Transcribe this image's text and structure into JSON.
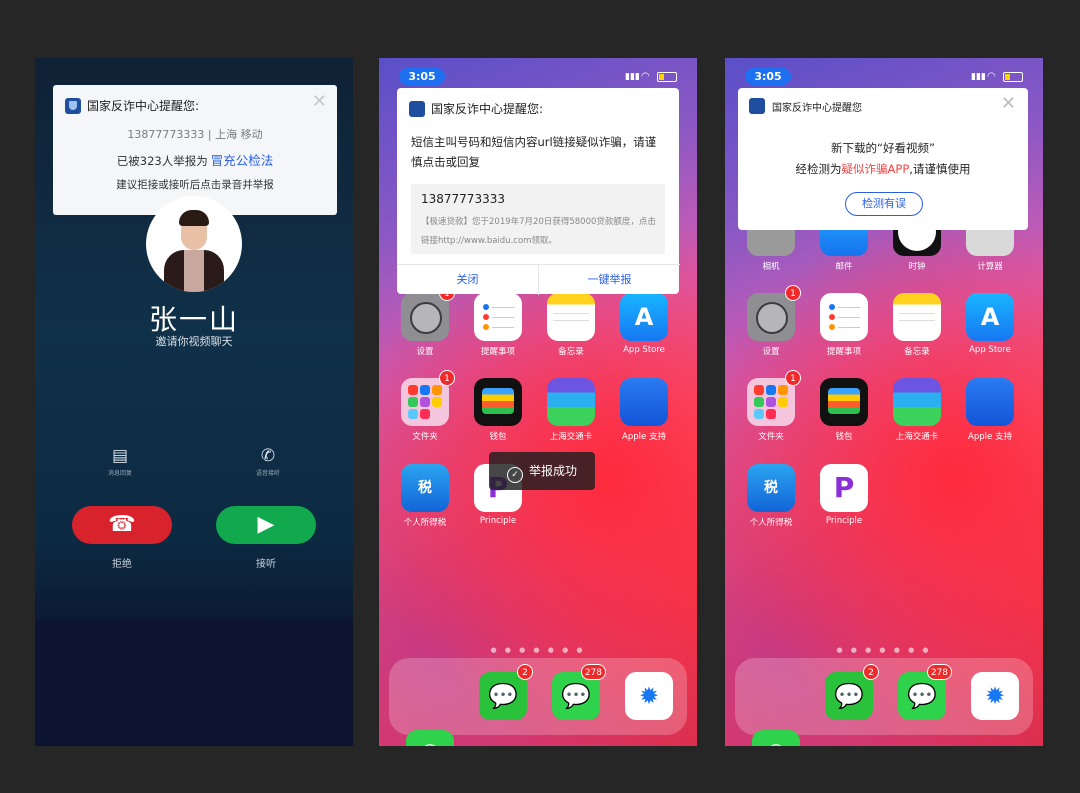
{
  "phone1": {
    "notification": {
      "title": "国家反诈中心提醒您:",
      "close": "✕",
      "number_line": "13877773333 | 上海 移动",
      "report_prefix": "已被323人举报为",
      "report_tag": "冒充公检法",
      "advice": "建议拒接或接听后点击录音并举报"
    },
    "caller_name": "张一山",
    "caller_subtitle": "邀请你视频聊天",
    "option_left": "消息回复",
    "option_right": "语音接听",
    "decline_label": "拒绝",
    "answer_label": "接听"
  },
  "phone2": {
    "time": "3:05",
    "notification": {
      "title": "国家反诈中心提醒您:",
      "body": "短信主叫号码和短信内容url链接疑似诈骗，请谨慎点击或回复",
      "sms_number": "13877773333",
      "sms_text": "【极速贷款】您于2019年7月20日获得58000贷款额度，点击链接http://www.baidu.com领取。",
      "action_close": "关闭",
      "action_report": "一键举报"
    },
    "toast": "举报成功"
  },
  "phone3": {
    "time": "3:05",
    "notification": {
      "title": "国家反诈中心提醒您",
      "close": "✕",
      "line1": "新下载的“好看视频”",
      "line2_prefix": "经检测为",
      "line2_warn": "疑似诈骗APP",
      "line2_suffix": ",请谨慎使用",
      "button": "检测有误"
    },
    "row0_labels": [
      "相机",
      "邮件",
      "时钟",
      "计算器"
    ]
  },
  "apps": {
    "settings": "设置",
    "reminders": "提醒事项",
    "notes": "备忘录",
    "appstore": "App Store",
    "folder": "文件夹",
    "wallet": "钱包",
    "transit": "上海交通卡",
    "applesupport": "Apple 支持",
    "tax": "个人所得税",
    "principle": "Principle"
  },
  "badges": {
    "settings": "1",
    "folder": "1",
    "wechat": "2",
    "messages": "278"
  },
  "icons": {
    "appstore_glyph": "A",
    "tax_glyph": "税",
    "principle_glyph": "P",
    "phone_glyph": "✆",
    "wechat_glyph": "💬",
    "messages_glyph": "💬",
    "safari_glyph": "✹",
    "apple_glyph": "",
    "check_glyph": "✓"
  },
  "colors": {
    "accent_blue": "#2a5ee6",
    "decline_red": "#d8232d",
    "answer_green": "#12a84e",
    "warning_red": "#f04444"
  }
}
